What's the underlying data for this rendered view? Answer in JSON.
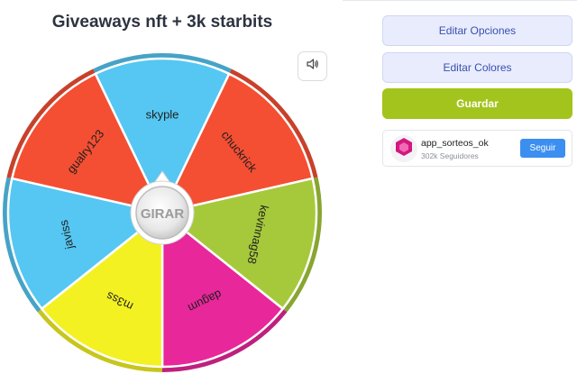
{
  "header": {
    "title": "Giveaways nft + 3k starbits"
  },
  "sound": {
    "icon": "speaker-icon"
  },
  "wheel": {
    "spin_label": "GIRAR",
    "segments": [
      {
        "label": "skyple",
        "color": "#55c7f2"
      },
      {
        "label": "chuckrick",
        "color": "#f44f33"
      },
      {
        "label": "kevinnag58",
        "color": "#a6c93c"
      },
      {
        "label": "dagum",
        "color": "#e8279a"
      },
      {
        "label": "m3ss",
        "color": "#f3f122"
      },
      {
        "label": "javiss",
        "color": "#55c7f2"
      },
      {
        "label": "gualry123",
        "color": "#f44f33"
      }
    ]
  },
  "panel": {
    "edit_options": "Editar Opciones",
    "edit_colors": "Editar Colores",
    "save": "Guardar"
  },
  "account": {
    "name": "app_sorteos_ok",
    "followers": "302k Seguidores",
    "follow_label": "Seguir",
    "avatar_icon": "hexagon-logo-icon"
  },
  "colors": {
    "accent_green": "#a3c41c",
    "follow_blue": "#3b8ff0",
    "light_button": "#e8ecfd"
  }
}
